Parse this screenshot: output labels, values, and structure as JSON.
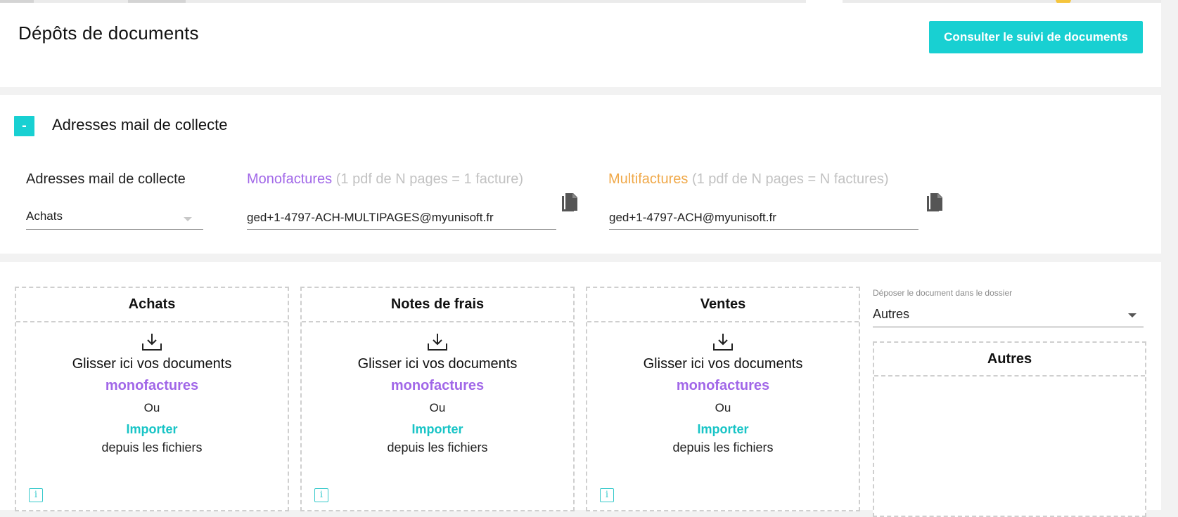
{
  "header": {
    "title": "Dépôts de documents",
    "track_button": "Consulter le suivi de documents"
  },
  "mail_section": {
    "toggle_symbol": "-",
    "title": "Adresses mail de collecte",
    "field_label": "Adresses mail de collecte",
    "journal_select": {
      "value": "Achats"
    },
    "mono": {
      "title": "Monofactures",
      "hint": "(1 pdf de N pages = 1 facture)",
      "color": "#a167e8",
      "email": "ged+1-4797-ACH-MULTIPAGES@myunisoft.fr"
    },
    "multi": {
      "title": "Multifactures",
      "hint": "(1 pdf de N pages = N factures)",
      "color": "#f0a94a",
      "email": "ged+1-4797-ACH@myunisoft.fr"
    }
  },
  "drop_zones": [
    {
      "title": "Achats",
      "drag_text": "Glisser ici vos documents",
      "type_text": "monofactures",
      "or_text": "Ou",
      "import_text": "Importer",
      "from_text": "depuis les fichiers"
    },
    {
      "title": "Notes de frais",
      "drag_text": "Glisser ici vos documents",
      "type_text": "monofactures",
      "or_text": "Ou",
      "import_text": "Importer",
      "from_text": "depuis les fichiers"
    },
    {
      "title": "Ventes",
      "drag_text": "Glisser ici vos documents",
      "type_text": "monofactures",
      "or_text": "Ou",
      "import_text": "Importer",
      "from_text": "depuis les fichiers"
    }
  ],
  "folder": {
    "label": "Déposer le document dans le dossier",
    "value": "Autres",
    "zone_title": "Autres"
  },
  "icons": {
    "copy": "copy-icon",
    "download": "download-tray-icon",
    "info": "info-icon",
    "caret": "chevron-down-icon"
  },
  "colors": {
    "accent": "#18d0d2",
    "mono": "#a167e8",
    "multi": "#f0a94a",
    "muted": "#c2c2c2"
  }
}
